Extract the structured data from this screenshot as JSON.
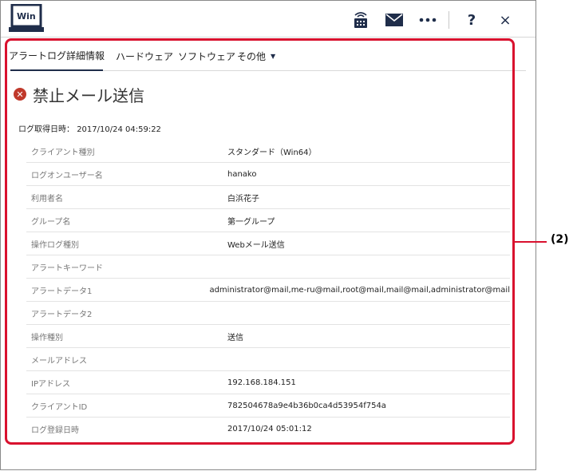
{
  "header": {
    "logo_text": "Win",
    "icons": [
      "network-terminal-icon",
      "mail-icon",
      "more-icon",
      "help-icon",
      "close-icon"
    ],
    "help_label": "?",
    "close_label": "×"
  },
  "tabs": [
    {
      "label": "アラートログ詳細情報",
      "active": true
    },
    {
      "label": "ハードウェア",
      "active": false
    },
    {
      "label": "ソフトウェア",
      "active": false
    },
    {
      "label": "その他",
      "active": false,
      "dropdown": true
    }
  ],
  "tab_caret": "▼",
  "detail": {
    "status_icon": "error-icon",
    "title": "禁止メール送信",
    "log_time_label": "ログ取得日時：",
    "log_time_value": "2017/10/24 04:59:22"
  },
  "rows": [
    {
      "label": "クライアント種別",
      "value": "スタンダード（Win64）"
    },
    {
      "label": "ログオンユーザー名",
      "value": "hanako"
    },
    {
      "label": "利用者名",
      "value": "白浜花子"
    },
    {
      "label": "グループ名",
      "value": "第一グループ"
    },
    {
      "label": "操作ログ種別",
      "value": "Webメール送信"
    },
    {
      "label": "アラートキーワード",
      "value": ""
    },
    {
      "label": "アラートデータ1",
      "value": "administrator@mail,me-ru@mail,root@mail,mail@mail,administrator@mail"
    },
    {
      "label": "アラートデータ2",
      "value": ""
    },
    {
      "label": "操作種別",
      "value": "送信"
    },
    {
      "label": "メールアドレス",
      "value": ""
    },
    {
      "label": "IPアドレス",
      "value": "192.168.184.151"
    },
    {
      "label": "クライアントID",
      "value": "782504678a9e4b36b0ca4d53954f754a"
    },
    {
      "label": "ログ登録日時",
      "value": "2017/10/24 05:01:12"
    }
  ],
  "annotation": {
    "label": "(2)",
    "color": "#d9112e"
  },
  "colors": {
    "accent": "#1f2d4a",
    "error": "#c0392b"
  }
}
